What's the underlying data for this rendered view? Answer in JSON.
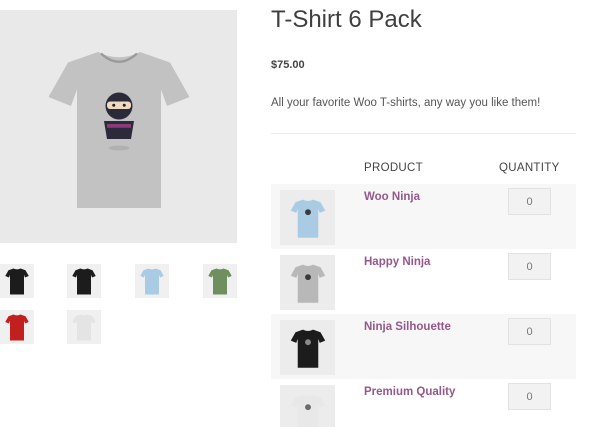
{
  "product": {
    "title": "T-Shirt 6 Pack",
    "price": "$75.00",
    "description": "All your favorite Woo T-shirts, any way you like them!"
  },
  "gallery": {
    "main_image": {
      "shirt_color": "#c2c2c2",
      "graphic": "ninja"
    },
    "thumbnails": [
      {
        "shirt_color": "#1c1c1c"
      },
      {
        "shirt_color": "#1c1c1c"
      },
      {
        "shirt_color": "#a9cbe3"
      },
      {
        "shirt_color": "#6f8f5f"
      },
      {
        "shirt_color": "#c21f1f"
      },
      {
        "shirt_color": "#e4e4e4"
      }
    ]
  },
  "grouped_table": {
    "headers": {
      "product": "PRODUCT",
      "quantity": "QUANTITY"
    },
    "rows": [
      {
        "name": "Woo Ninja",
        "quantity": "0",
        "shirt_color": "#a9cbe3"
      },
      {
        "name": "Happy Ninja",
        "quantity": "0",
        "shirt_color": "#b8b8b8"
      },
      {
        "name": "Ninja Silhouette",
        "quantity": "0",
        "shirt_color": "#1c1c1c"
      },
      {
        "name": "Premium Quality",
        "quantity": "0",
        "shirt_color": "#e8e8e8"
      }
    ]
  },
  "colors": {
    "link": "#96588a",
    "row_shade": "#f7f7f7",
    "image_bg": "#e9e9e9"
  }
}
